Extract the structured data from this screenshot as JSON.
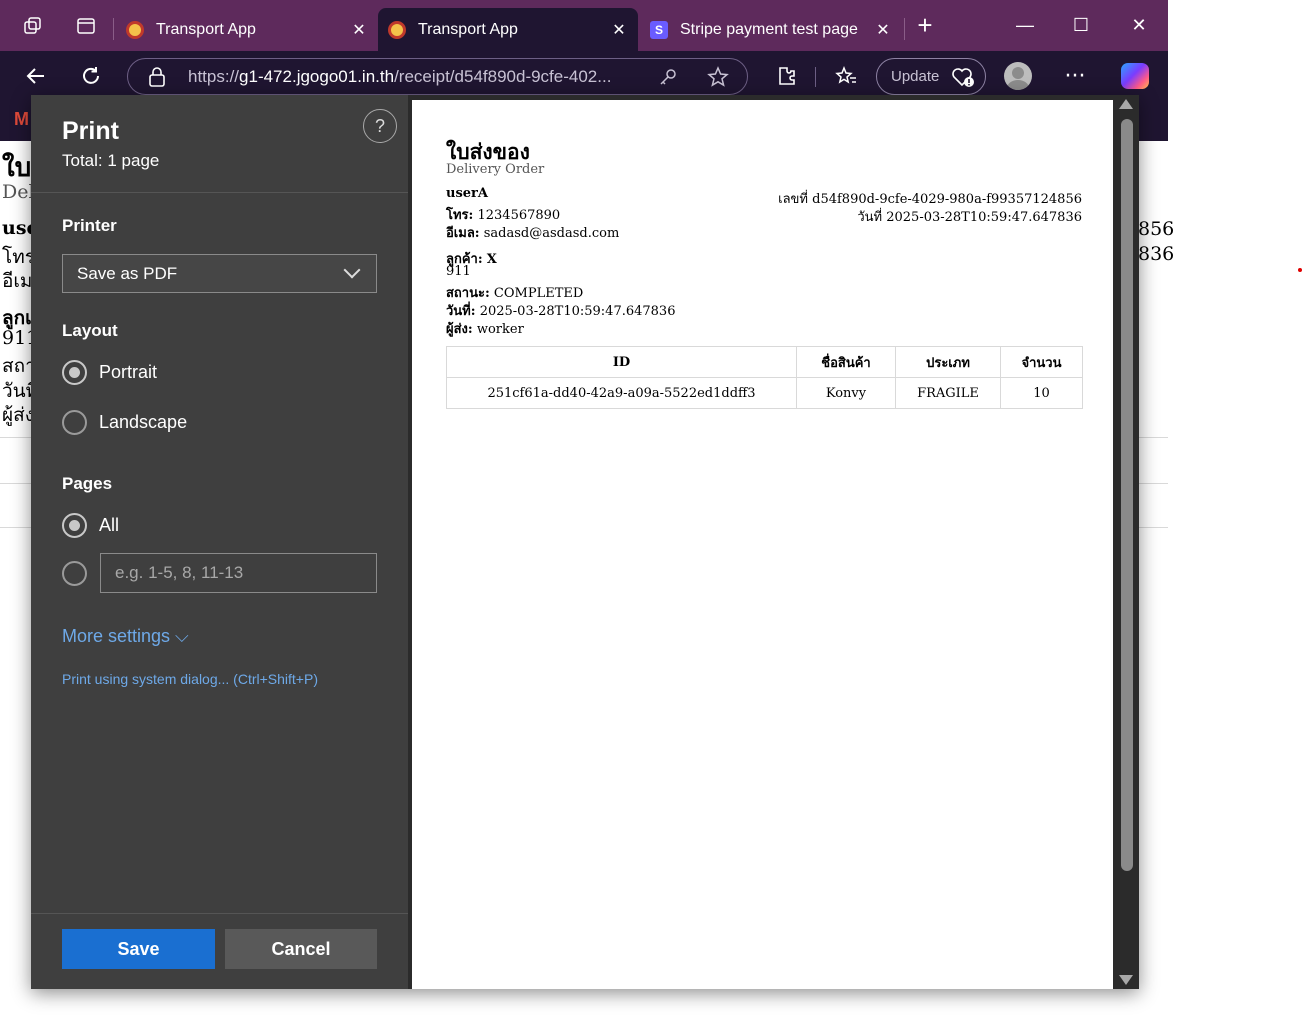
{
  "browser": {
    "tabs": [
      {
        "title": "Transport App",
        "close": "✕"
      },
      {
        "title": "Transport App",
        "close": "✕"
      },
      {
        "title": "Stripe payment test page",
        "close": "✕"
      }
    ],
    "new_tab": "+",
    "window": {
      "minimize": "—",
      "maximize": "☐",
      "close": "✕"
    },
    "url_prefix": "https://",
    "url_host": "g1-472.jgogo01.in.th",
    "url_path": "/receipt/d54f890d-9cfe-402...",
    "update_label": "Update",
    "more_label": "···"
  },
  "background_page": {
    "title_partial": "ใบ",
    "subtitle_partial": "Del",
    "lines": [
      "user",
      "โทร",
      "อีเม",
      "ลูกเ",
      "911",
      "สถา",
      "วันที",
      "ผู้ส่ง"
    ],
    "right_fragments": [
      "856",
      "836"
    ]
  },
  "print_dialog": {
    "title": "Print",
    "total": "Total: 1 page",
    "help": "?",
    "printer_label": "Printer",
    "printer_value": "Save as PDF",
    "layout_label": "Layout",
    "layout_options": [
      "Portrait",
      "Landscape"
    ],
    "layout_selected": "Portrait",
    "pages_label": "Pages",
    "pages_all": "All",
    "pages_placeholder": "e.g. 1-5, 8, 11-13",
    "more_settings": "More settings ⌵",
    "system_dialog": "Print using system dialog... (Ctrl+Shift+P)",
    "save_label": "Save",
    "cancel_label": "Cancel"
  },
  "receipt": {
    "title": "ใบส่งของ",
    "subtitle": "Delivery Order",
    "username": "userA",
    "phone_label": "โทร:",
    "phone": "1234567890",
    "email_label": "อีเมล:",
    "email": "sadasd@asdasd.com",
    "receipt_no": "เลขที่ d54f890d-9cfe-4029-980a-f99357124856",
    "receipt_date": "วันที่ 2025-03-28T10:59:47.647836",
    "customer_label": "ลูกค้า:",
    "customer": "X",
    "customer_phone": "911",
    "status_label": "สถานะ:",
    "status": "COMPLETED",
    "date_label": "วันที่:",
    "date": "2025-03-28T10:59:47.647836",
    "sender_label": "ผู้ส่ง:",
    "sender": "worker",
    "table": {
      "headers": [
        "ID",
        "ชื่อสินค้า",
        "ประเภท",
        "จำนวน"
      ],
      "rows": [
        [
          "251cf61a-dd40-42a9-a09a-5522ed1ddff3",
          "Konvy",
          "FRAGILE",
          "10"
        ]
      ]
    }
  }
}
